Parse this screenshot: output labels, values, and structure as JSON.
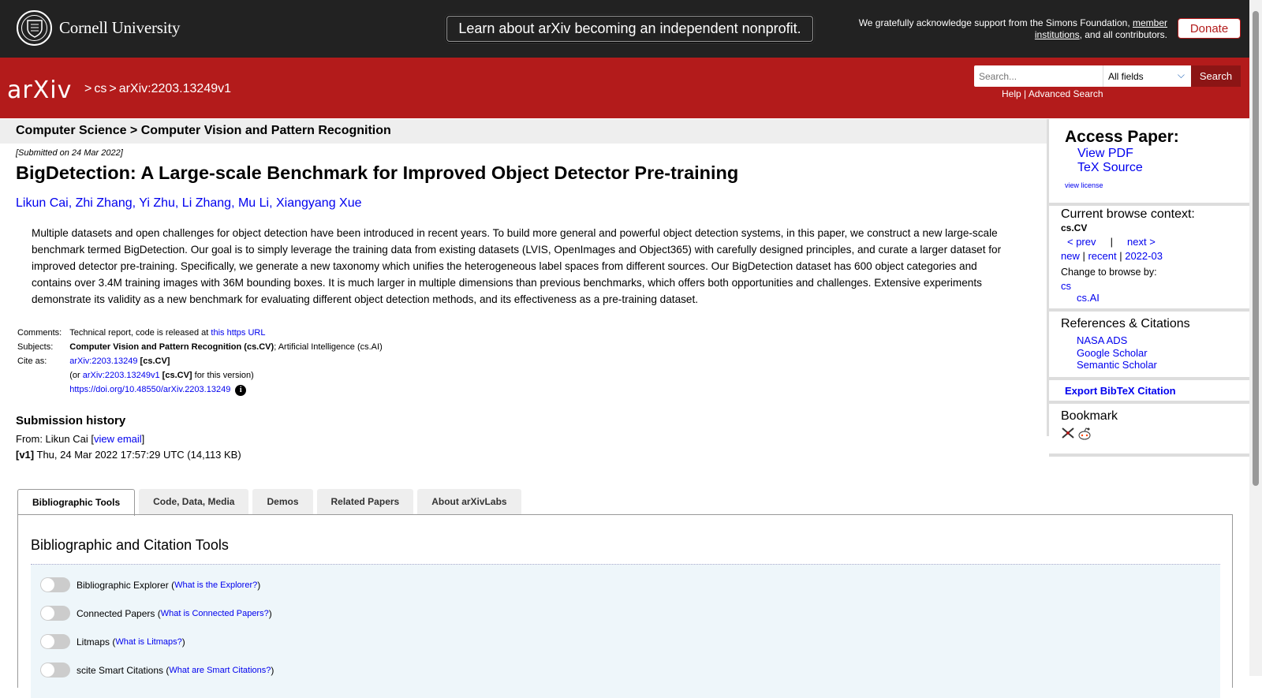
{
  "topbar": {
    "institution": "Cornell University",
    "nonprofit_banner": "Learn about arXiv becoming an independent nonprofit.",
    "ack_text": "We gratefully acknowledge support from the Simons Foundation, ",
    "ack_link": "member institutions",
    "ack_tail": ", and all contributors.",
    "donate": "Donate"
  },
  "header": {
    "logo": "arXiv",
    "breadcrumb_sep": ">",
    "breadcrumb_cat": "cs",
    "breadcrumb_id": "arXiv:2203.13249v1",
    "search_placeholder": "Search...",
    "search_field": "All fields",
    "search_button": "Search",
    "help": "Help",
    "help_sep": " | ",
    "advanced": "Advanced Search"
  },
  "paper": {
    "subject_header": "Computer Science > Computer Vision and Pattern Recognition",
    "submitted": "[Submitted on 24 Mar 2022]",
    "title": "BigDetection: A Large-scale Benchmark for Improved Object Detector Pre-training",
    "authors": [
      "Likun Cai",
      "Zhi Zhang",
      "Yi Zhu",
      "Li Zhang",
      "Mu Li",
      "Xiangyang Xue"
    ],
    "abstract_lines": [
      "Multiple datasets and open challenges for object detection have been introduced in recent years. To build more general and powerful object detection systems, in this paper, we construct a new large-scale",
      "benchmark termed BigDetection. Our goal is to simply leverage the training data from existing datasets (LVIS, OpenImages and Object365) with carefully designed principles, and curate a larger dataset for",
      "improved detector pre-training. Specifically, we generate a new taxonomy which unifies the heterogeneous label spaces from different sources. Our BigDetection dataset has 600 object categories and",
      "contains over 3.4M training images with 36M bounding boxes. It is much larger in multiple dimensions than previous benchmarks, which offers both opportunities and challenges. Extensive experiments",
      "demonstrate its validity as a new benchmark for evaluating different object detection methods, and its effectiveness as a pre-training dataset."
    ],
    "comments_label": "Comments:",
    "comments_text": "Technical report, code is released at ",
    "comments_link": "this https URL",
    "subjects_label": "Subjects:",
    "subjects_primary": "Computer Vision and Pattern Recognition (cs.CV)",
    "subjects_rest": "; Artificial Intelligence (cs.AI)",
    "cite_label": "Cite as:",
    "cite_id": "arXiv:2203.13249",
    "cite_cat": " [cs.CV]",
    "cite_or": "(or ",
    "cite_version": "arXiv:2203.13249v1",
    "cite_version_cat": " [cs.CV]",
    "cite_version_tail": " for this version)",
    "doi": "https://doi.org/10.48550/arXiv.2203.13249",
    "history_title": "Submission history",
    "from_prefix": "From: Likun Cai [",
    "from_link": "view email",
    "from_suffix": "]",
    "v1_label": "[v1]",
    "v1_text": " Thu, 24 Mar 2022 17:57:29 UTC (14,113 KB)"
  },
  "tabs": [
    "Bibliographic Tools",
    "Code, Data, Media",
    "Demos",
    "Related Papers",
    "About arXivLabs"
  ],
  "tools": {
    "title": "Bibliographic and Citation Tools",
    "rows": [
      {
        "label": "Bibliographic Explorer",
        "link": "What is the Explorer?"
      },
      {
        "label": "Connected Papers",
        "link": "What is Connected Papers?"
      },
      {
        "label": "Litmaps",
        "link": "What is Litmaps?"
      },
      {
        "label": "scite Smart Citations",
        "link": "What are Smart Citations?"
      }
    ]
  },
  "sidebar": {
    "access_title": "Access Paper:",
    "view_pdf": "View PDF",
    "tex_source": "TeX Source",
    "view_license": "view license",
    "context_title": "Current browse context:",
    "context_cat": "cs.CV",
    "prev": "< prev",
    "nav_sep": "|",
    "next": "next >",
    "new": "new",
    "recent": "recent",
    "month": "2022-03",
    "change_to": "Change to browse by:",
    "browse_cs": "cs",
    "browse_csai": "cs.AI",
    "refs_title": "References & Citations",
    "nasa": "NASA ADS",
    "scholar": "Google Scholar",
    "semantic": "Semantic Scholar",
    "bibtex": "Export BibTeX Citation",
    "bookmark_title": "Bookmark"
  },
  "colors": {
    "arxiv_red": "#b31b1b",
    "link": "#0000ee",
    "topbar": "#222222"
  }
}
